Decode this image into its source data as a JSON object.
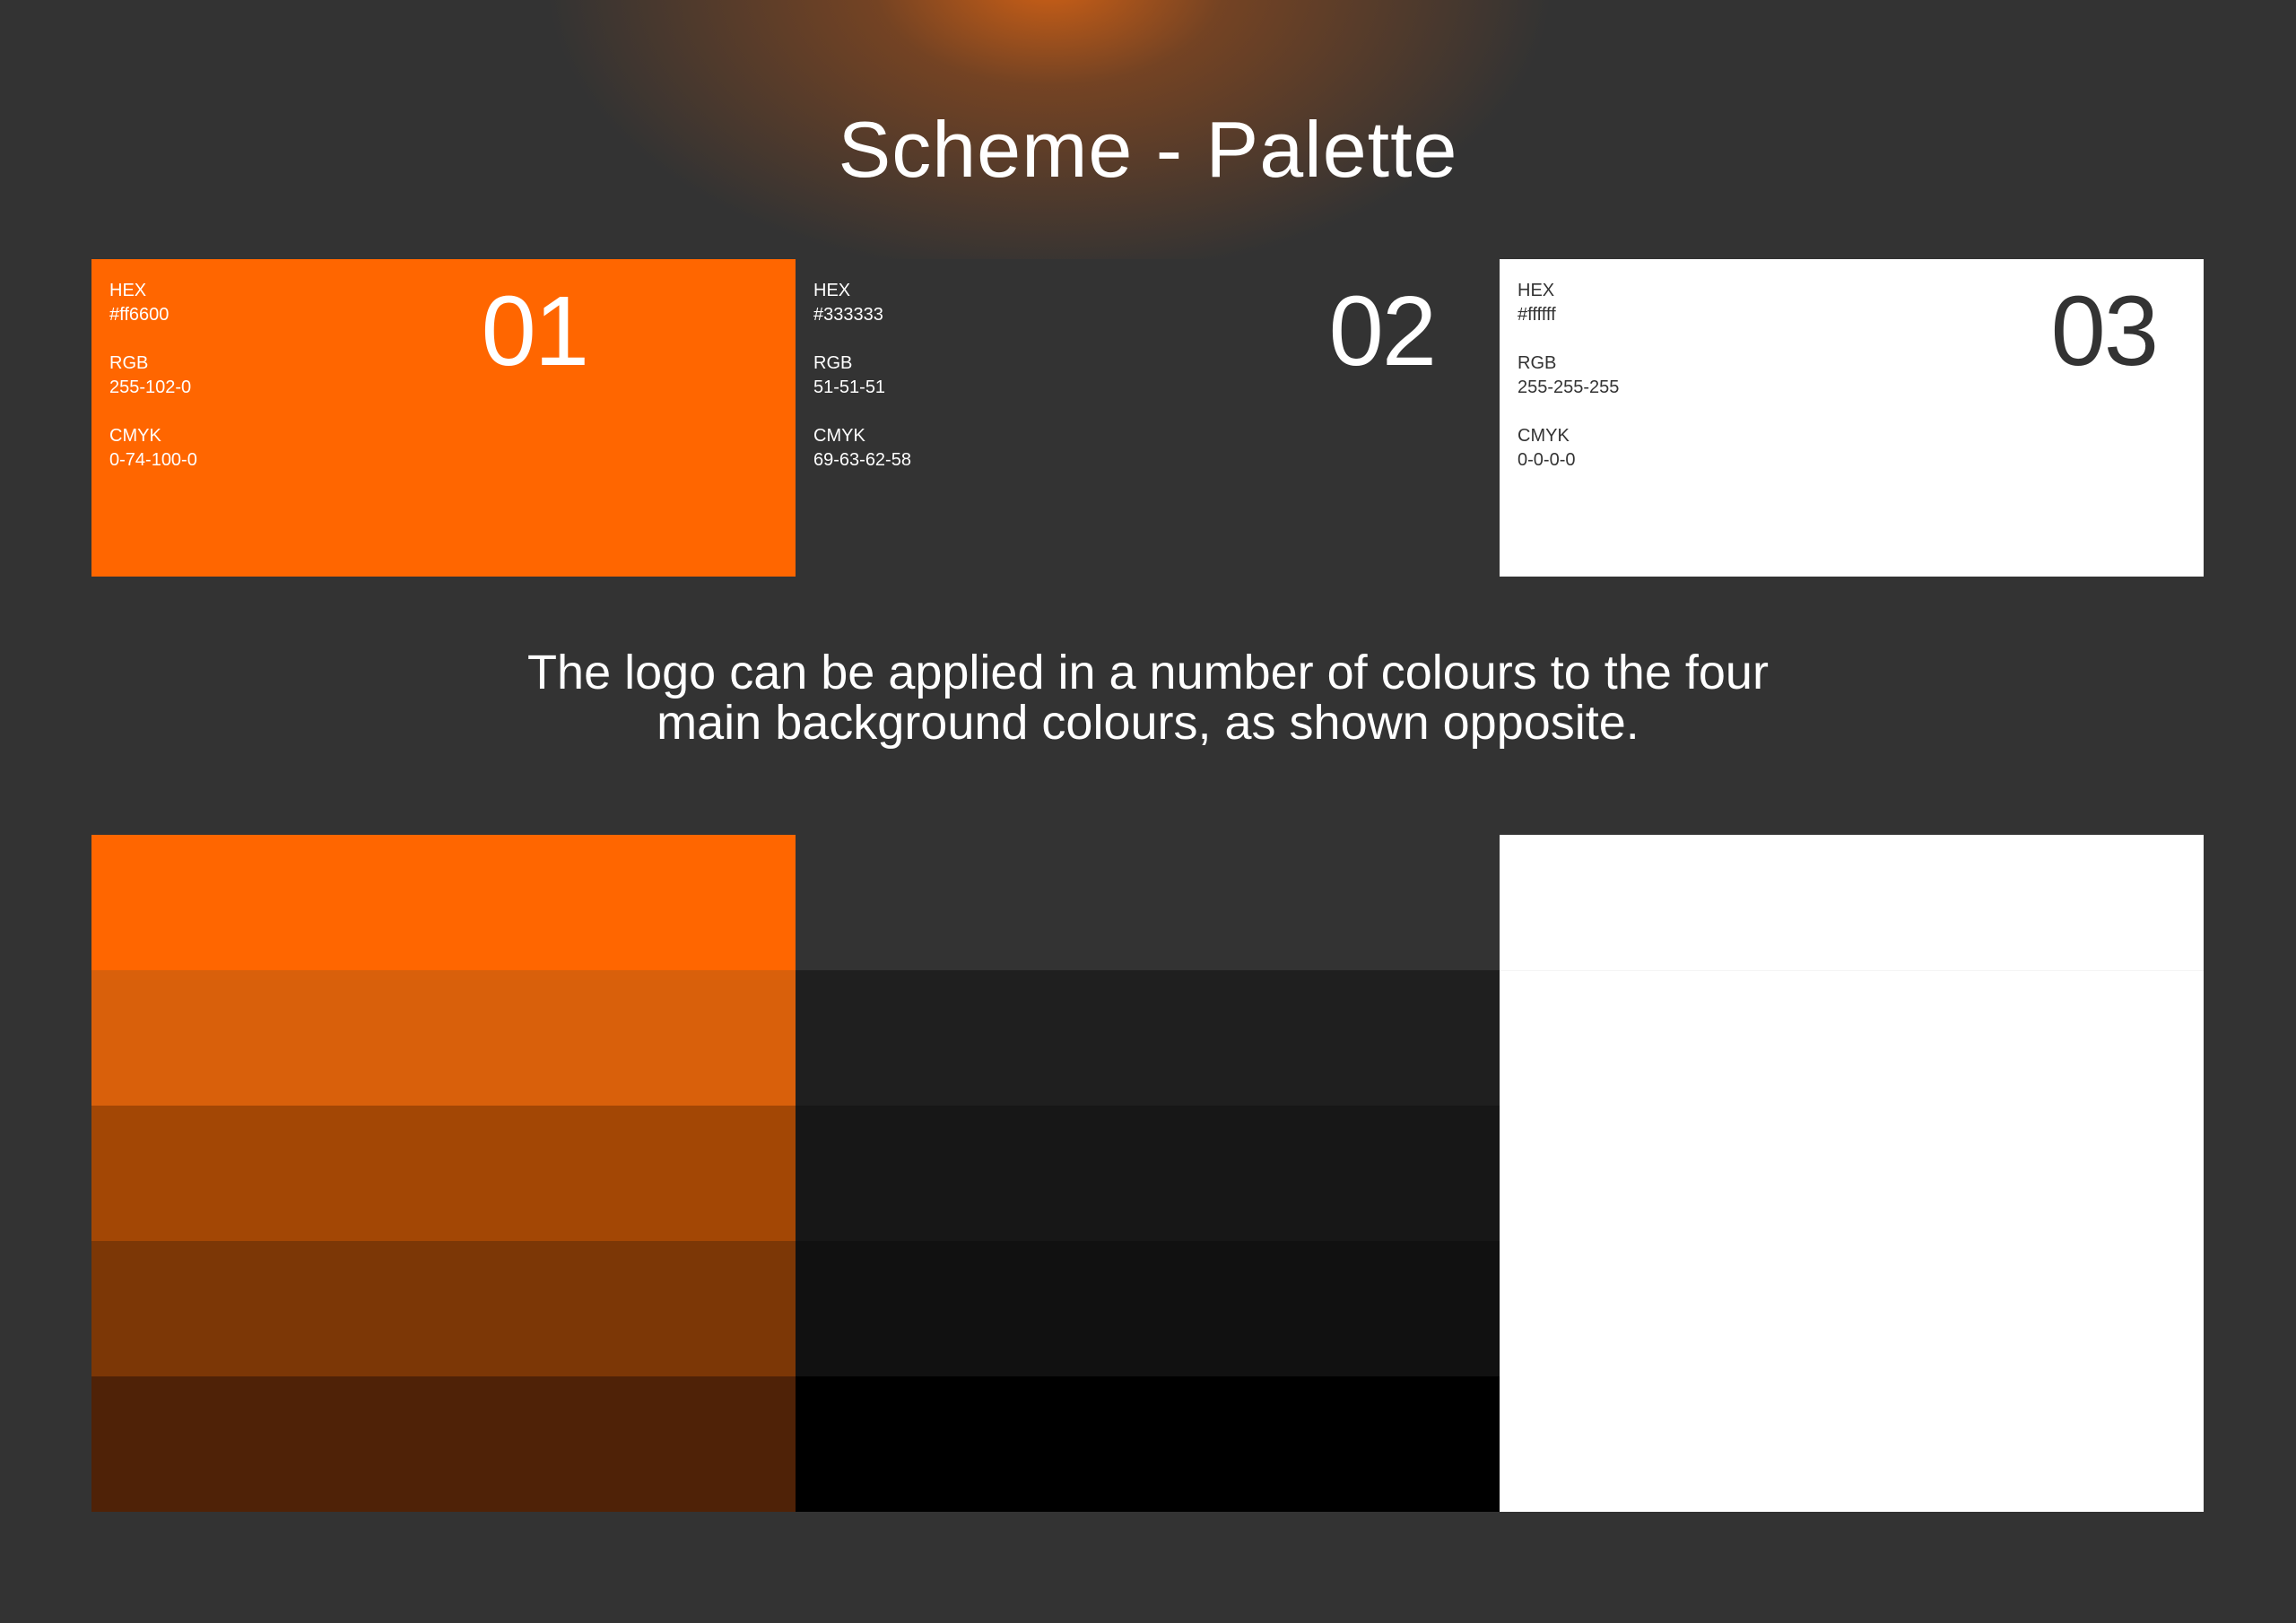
{
  "title": "Scheme - Palette",
  "swatches": [
    {
      "number": "01",
      "color": "#ff6600",
      "hex_label": "HEX",
      "hex_value": "#ff6600",
      "rgb_label": "RGB",
      "rgb_value": "255-102-0",
      "cmyk_label": "CMYK",
      "cmyk_value": "0-74-100-0"
    },
    {
      "number": "02",
      "color": "#333333",
      "hex_label": "HEX",
      "hex_value": "#333333",
      "rgb_label": "RGB",
      "rgb_value": "51-51-51",
      "cmyk_label": "CMYK",
      "cmyk_value": "69-63-62-58"
    },
    {
      "number": "03",
      "color": "#ffffff",
      "hex_label": "HEX",
      "hex_value": "#ffffff",
      "rgb_label": "RGB",
      "rgb_value": "255-255-255",
      "cmyk_label": "CMYK",
      "cmyk_value": "0-0-0-0"
    }
  ],
  "description": {
    "line1": "The logo can be applied in a number of colours to the four",
    "line2": "main background colours, as shown opposite."
  },
  "shades": {
    "orange": [
      "#ff6600",
      "#d9600b",
      "#a34705",
      "#7c3706",
      "#4f2207"
    ],
    "dark": [
      "#333333",
      "#1f1f1f",
      "#171717",
      "#111111",
      "#000000"
    ],
    "white": [
      "#ffffff",
      "#ffffff",
      "#ffffff",
      "#ffffff",
      "#ffffff"
    ]
  }
}
